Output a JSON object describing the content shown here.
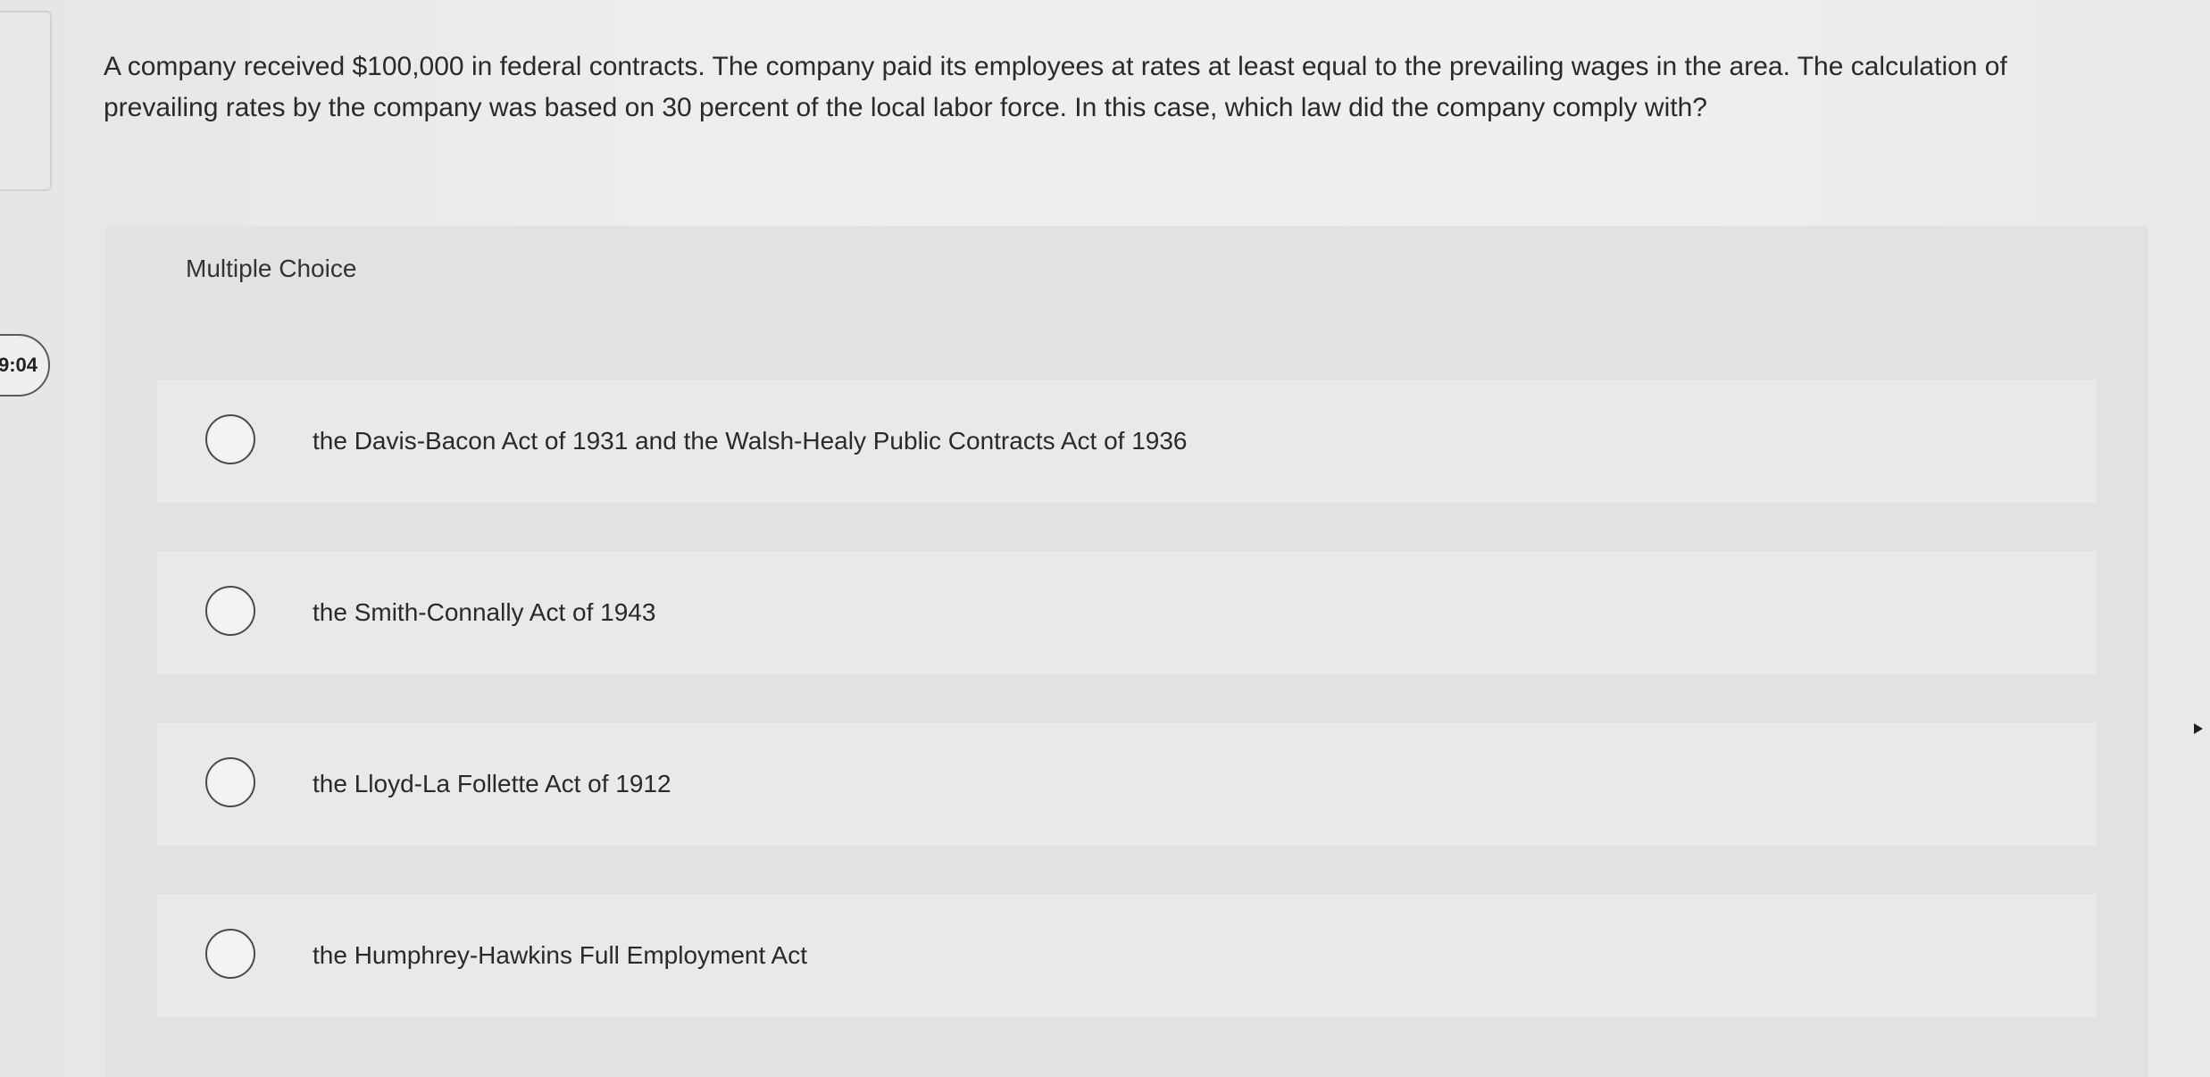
{
  "timer": {
    "display": "9:04"
  },
  "question": {
    "text": "A company received $100,000 in federal contracts. The company paid its employees at rates at least equal to the prevailing wages in the area. The calculation of prevailing rates by the company was based on 30 percent of the local labor force. In this case, which law did the company comply with?"
  },
  "answer_panel": {
    "label": "Multiple Choice",
    "options": [
      {
        "label": "the Davis-Bacon Act of 1931 and the Walsh-Healy Public Contracts Act of 1936",
        "selected": false
      },
      {
        "label": "the Smith-Connally Act of 1943",
        "selected": false
      },
      {
        "label": "the Lloyd-La Follette Act of 1912",
        "selected": false
      },
      {
        "label": "the Humphrey-Hawkins Full Employment Act",
        "selected": false
      }
    ]
  },
  "icons": {
    "radio": "radio-unchecked-icon",
    "edge_arrow": "play-arrow-icon"
  }
}
